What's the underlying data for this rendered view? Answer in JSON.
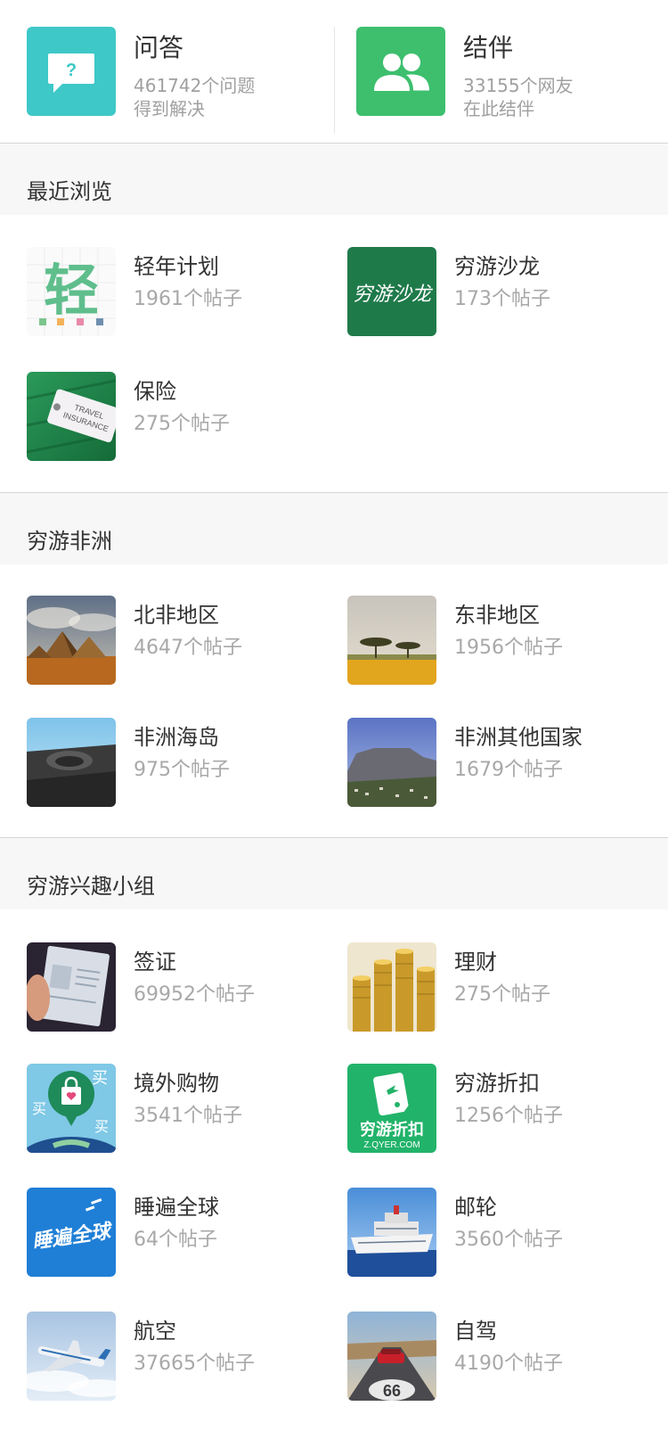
{
  "top": {
    "qa": {
      "title": "问答",
      "line1": "461742个问题",
      "line2": "得到解决",
      "icon": "question-bubble-icon",
      "color": "#3ec8c8"
    },
    "companion": {
      "title": "结伴",
      "line1": "33155个网友",
      "line2": "在此结伴",
      "icon": "people-icon",
      "color": "#3dbf6e"
    }
  },
  "sections": [
    {
      "title": "最近浏览",
      "items": [
        {
          "name": "轻年计划",
          "count": "1961个帖子",
          "logo_text": "轻"
        },
        {
          "name": "穷游沙龙",
          "count": "173个帖子",
          "logo_text": "穷游沙龙"
        },
        {
          "name": "保险",
          "count": "275个帖子",
          "tag_line1": "TRAVEL",
          "tag_line2": "INSURANCE"
        }
      ]
    },
    {
      "title": "穷游非洲",
      "items": [
        {
          "name": "北非地区",
          "count": "4647个帖子"
        },
        {
          "name": "东非地区",
          "count": "1956个帖子"
        },
        {
          "name": "非洲海岛",
          "count": "975个帖子"
        },
        {
          "name": "非洲其他国家",
          "count": "1679个帖子"
        }
      ]
    },
    {
      "title": "穷游兴趣小组",
      "items": [
        {
          "name": "签证",
          "count": "69952个帖子"
        },
        {
          "name": "理财",
          "count": "275个帖子"
        },
        {
          "name": "境外购物",
          "count": "3541个帖子",
          "logo_text": "买"
        },
        {
          "name": "穷游折扣",
          "count": "1256个帖子",
          "logo_text": "穷游折扣",
          "logo_sub": "Z.QYER.COM"
        },
        {
          "name": "睡遍全球",
          "count": "64个帖子",
          "logo_text": "睡遍全球"
        },
        {
          "name": "邮轮",
          "count": "3560个帖子"
        },
        {
          "name": "航空",
          "count": "37665个帖子"
        },
        {
          "name": "自驾",
          "count": "4190个帖子",
          "logo_text": "66"
        }
      ]
    }
  ]
}
